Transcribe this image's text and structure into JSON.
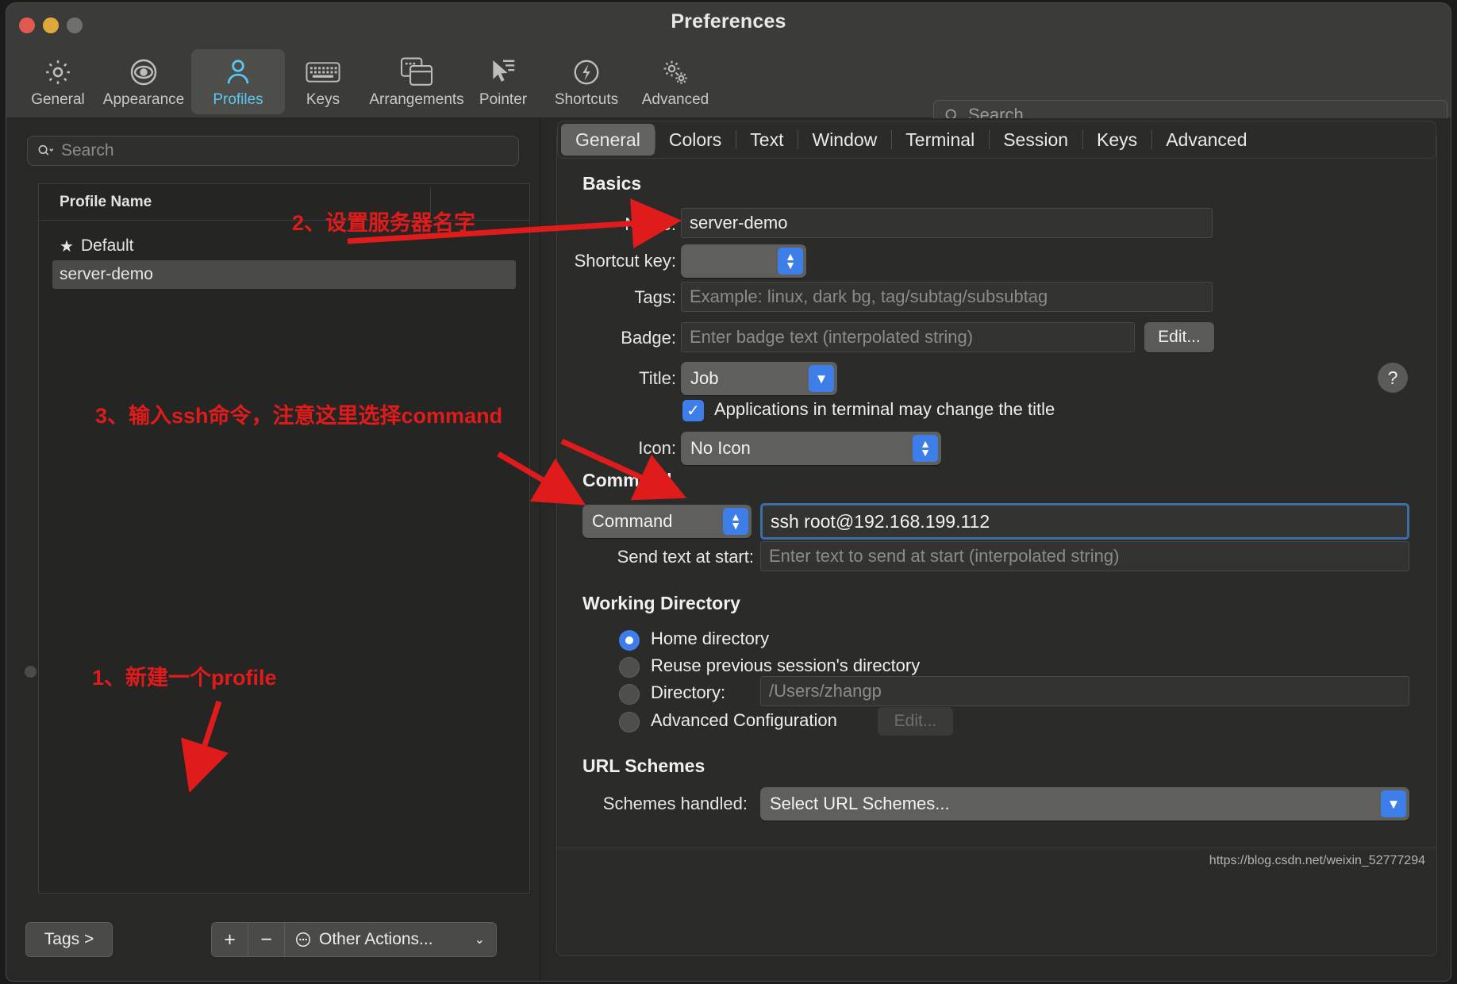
{
  "window": {
    "title": "Preferences"
  },
  "toolbar": {
    "items": [
      {
        "label": "General",
        "icon": "gear-icon"
      },
      {
        "label": "Appearance",
        "icon": "eye-icon"
      },
      {
        "label": "Profiles",
        "icon": "person-icon"
      },
      {
        "label": "Keys",
        "icon": "keyboard-icon"
      },
      {
        "label": "Arrangements",
        "icon": "windows-icon"
      },
      {
        "label": "Pointer",
        "icon": "cursor-icon"
      },
      {
        "label": "Shortcuts",
        "icon": "bolt-icon"
      },
      {
        "label": "Advanced",
        "icon": "gears-icon"
      }
    ],
    "selected": "Profiles",
    "search_placeholder": "Search",
    "search_caption": "Search",
    "search_icon": "search-icon"
  },
  "sidebar": {
    "search_placeholder": "Search",
    "search_icon": "search-dropdown-icon",
    "column_header": "Profile Name",
    "profiles": [
      {
        "name": "Default",
        "starred": true,
        "selected": false
      },
      {
        "name": "server-demo",
        "starred": false,
        "selected": true
      }
    ],
    "bottom": {
      "tags_label": "Tags >",
      "add_label": "+",
      "remove_label": "−",
      "other_actions_label": "Other Actions...",
      "other_actions_icon": "ellipsis-circle-icon",
      "chevron": "⌄"
    }
  },
  "main": {
    "tabs": [
      {
        "label": "General",
        "active": true
      },
      {
        "label": "Colors",
        "active": false
      },
      {
        "label": "Text",
        "active": false
      },
      {
        "label": "Window",
        "active": false
      },
      {
        "label": "Terminal",
        "active": false
      },
      {
        "label": "Session",
        "active": false
      },
      {
        "label": "Keys",
        "active": false
      },
      {
        "label": "Advanced",
        "active": false
      }
    ],
    "sections": {
      "basics": "Basics",
      "command": "Command",
      "working_directory": "Working Directory",
      "url_schemes": "URL Schemes"
    },
    "basics": {
      "name_label": "Name:",
      "name_value": "server-demo",
      "shortcut_label": "Shortcut key:",
      "shortcut_value": "",
      "tags_label": "Tags:",
      "tags_placeholder": "Example: linux, dark bg, tag/subtag/subsubtag",
      "badge_label": "Badge:",
      "badge_placeholder": "Enter badge text (interpolated string)",
      "badge_edit_label": "Edit...",
      "title_label": "Title:",
      "title_value": "Job",
      "help_label": "?",
      "change_title_checkbox": "Applications in terminal may change the title",
      "change_title_checked": true,
      "icon_label": "Icon:",
      "icon_value": "No Icon"
    },
    "command": {
      "type_value": "Command",
      "command_value": "ssh root@192.168.199.112",
      "send_text_label": "Send text at start:",
      "send_text_placeholder": "Enter text to send at start (interpolated string)"
    },
    "working_directory": {
      "options": [
        {
          "label": "Home directory",
          "selected": true
        },
        {
          "label": "Reuse previous session's directory",
          "selected": false
        },
        {
          "label": "Directory:",
          "selected": false
        },
        {
          "label": "Advanced Configuration",
          "selected": false
        }
      ],
      "directory_placeholder": "/Users/zhangp",
      "advanced_edit_label": "Edit..."
    },
    "url_schemes": {
      "schemes_label": "Schemes handled:",
      "schemes_value": "Select URL Schemes..."
    }
  },
  "annotations": [
    {
      "text": "2、设置服务器名字"
    },
    {
      "text": "3、输入ssh命令，注意这里选择command"
    },
    {
      "text": "1、新建一个profile"
    }
  ],
  "watermark": "https://blog.csdn.net/weixin_52777294",
  "colors": {
    "accent_blue": "#3d7ee8",
    "selected_tab_blue": "#5ac8f5",
    "annotation_red": "#e01b1b",
    "window_bg": "#3b3b39",
    "panel_bg": "#2b2b29"
  }
}
